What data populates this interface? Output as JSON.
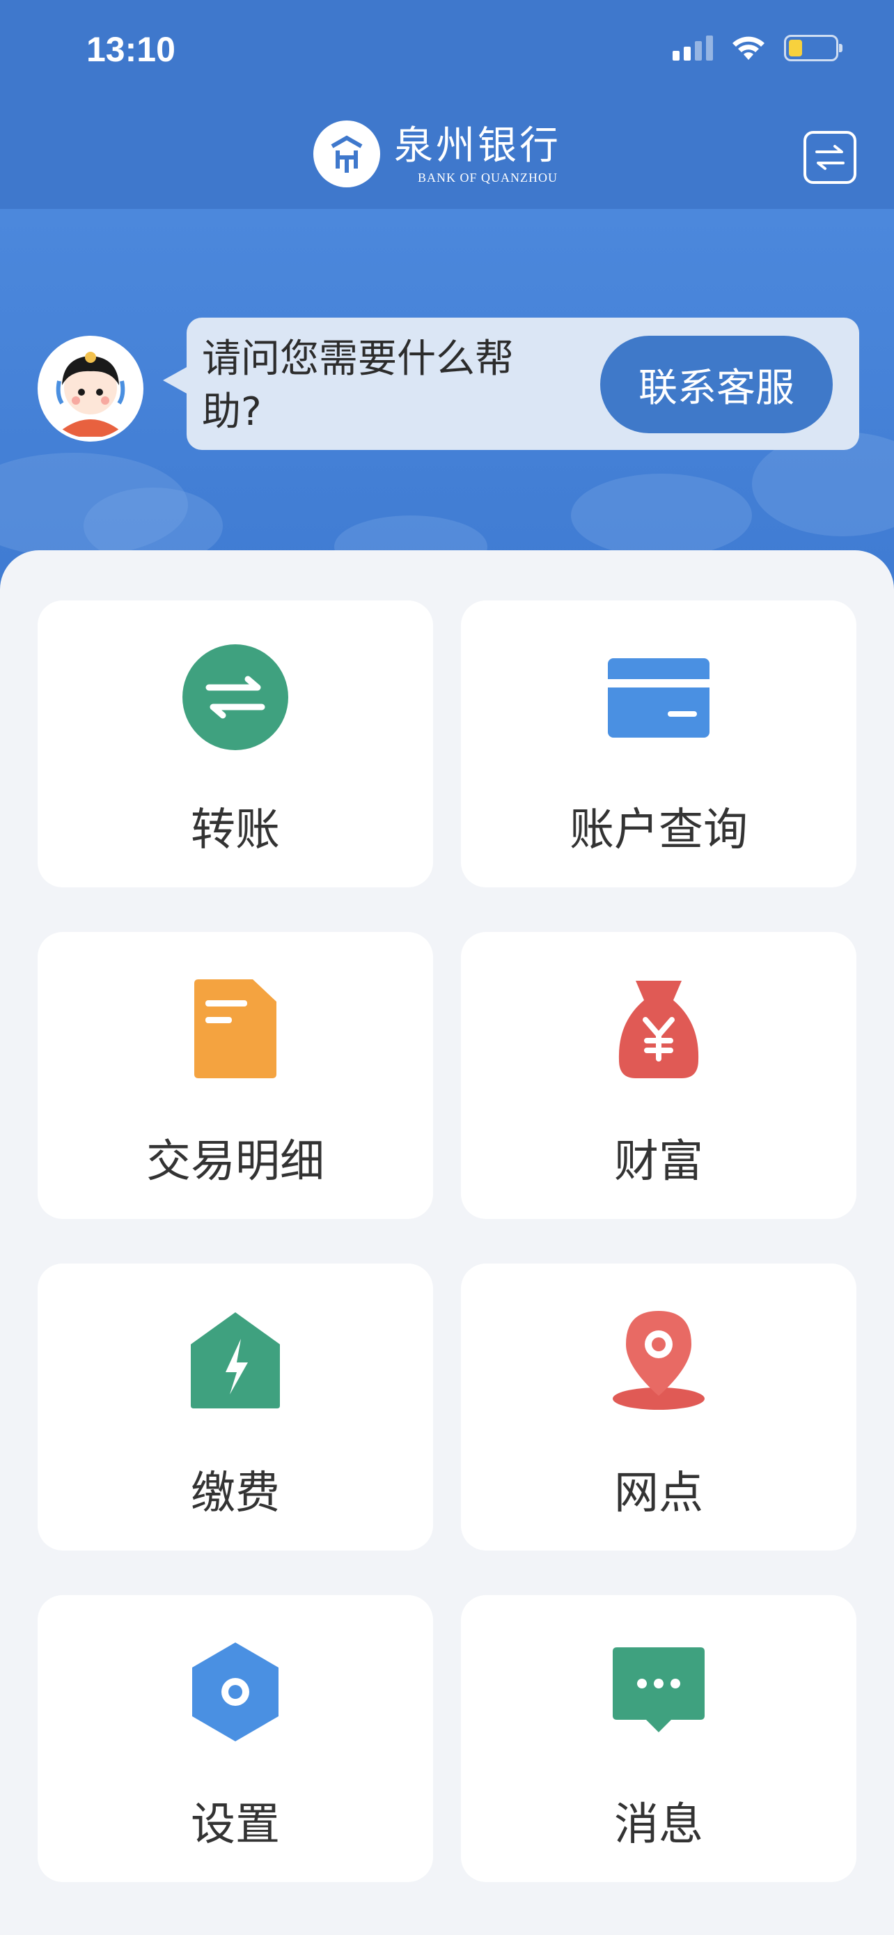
{
  "status_bar": {
    "time": "13:10"
  },
  "header": {
    "bank_name": "泉州银行",
    "bank_name_en": "BANK OF QUANZHOU",
    "brand_color": "#4479cb"
  },
  "assistant": {
    "question": "请问您需要什么帮助?",
    "contact_button": "联系客服"
  },
  "menu": {
    "items": [
      {
        "label": "转账",
        "icon": "transfer-icon",
        "color": "#3fa17f"
      },
      {
        "label": "账户查询",
        "icon": "card-icon",
        "color": "#4a90e2"
      },
      {
        "label": "交易明细",
        "icon": "document-icon",
        "color": "#f4a340"
      },
      {
        "label": "财富",
        "icon": "money-bag-icon",
        "color": "#e05a55"
      },
      {
        "label": "缴费",
        "icon": "bolt-house-icon",
        "color": "#3fa17f"
      },
      {
        "label": "网点",
        "icon": "location-pin-icon",
        "color": "#e05a55"
      },
      {
        "label": "设置",
        "icon": "hexagon-settings-icon",
        "color": "#4a90e2"
      },
      {
        "label": "消息",
        "icon": "chat-icon",
        "color": "#3fa17f"
      }
    ]
  }
}
